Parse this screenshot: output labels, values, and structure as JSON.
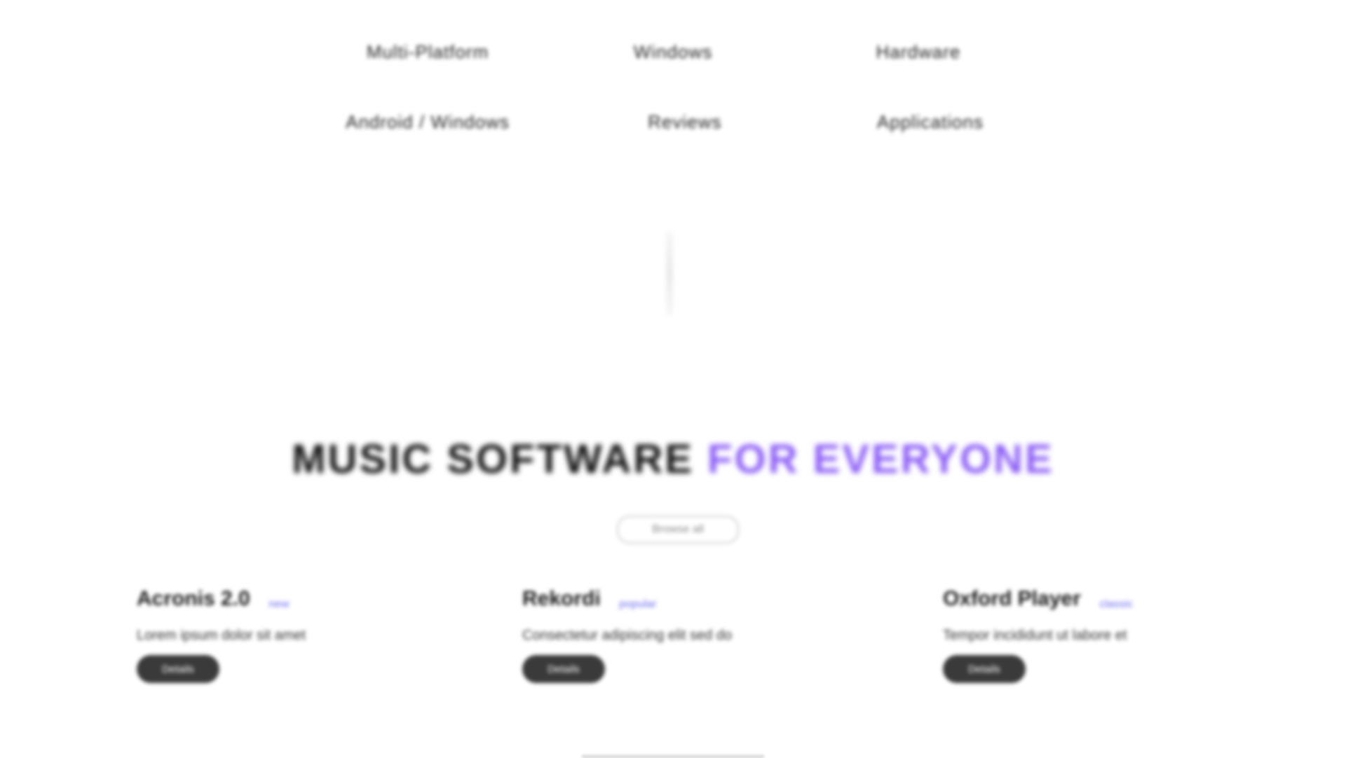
{
  "nav": {
    "row1": [
      "Multi-Platform",
      "Windows",
      "Hardware"
    ],
    "row2": [
      "Android / Windows",
      "Reviews",
      "Applications"
    ]
  },
  "hero": {
    "headline_main": "MUSIC SOFTWARE",
    "headline_accent": "FOR EVERYONE",
    "button_label": "Browse all",
    "accent_color": "#8b5cf6"
  },
  "features": [
    {
      "title": "Acronis 2.0",
      "tag": "new",
      "description": "Lorem ipsum dolor sit amet",
      "button": "Details"
    },
    {
      "title": "Rekordi",
      "tag": "popular",
      "description": "Consectetur adipiscing elit sed do",
      "button": "Details"
    },
    {
      "title": "Oxford Player",
      "tag": "classic",
      "description": "Tempor incididunt ut labore et",
      "button": "Details"
    }
  ]
}
